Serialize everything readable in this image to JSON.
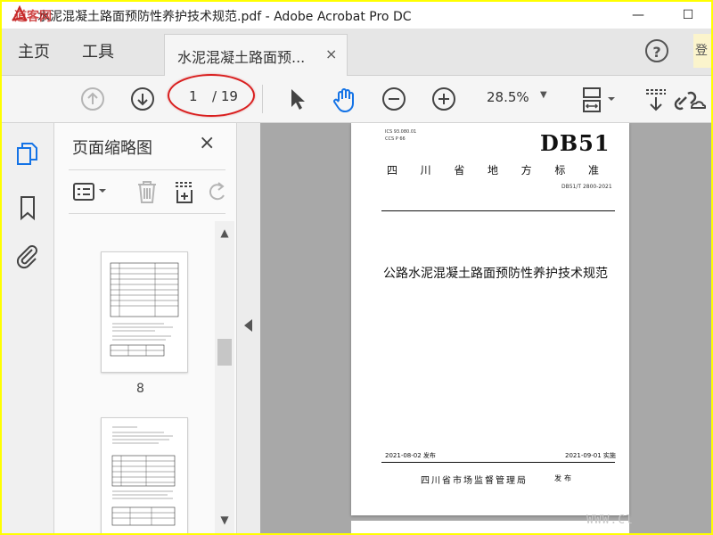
{
  "window": {
    "title": "水泥混凝土路面预防性养护技术规范.pdf - Adobe Acrobat Pro DC",
    "minimize_glyph": "—",
    "maximize_glyph": "☐"
  },
  "tabs": {
    "home_label": "主页",
    "tools_label": "工具",
    "doc_tab_label": "水泥混凝土路面预...",
    "doc_tab_close": "×",
    "help_glyph": "?",
    "signin_label": "登"
  },
  "toolbar": {
    "page_current": "1",
    "page_total": "/ 19",
    "zoom_value": "28.5%"
  },
  "thumbnail_panel": {
    "title": "页面缩略图",
    "close_glyph": "×",
    "pages": [
      {
        "number": "8"
      }
    ]
  },
  "document": {
    "ics_line1": "ICS 93.080.01",
    "ics_line2": "CCS P 66",
    "standard_code": "DB51",
    "province_standard": "四川省地方标准",
    "standard_number": "DB51/T 2800-2021",
    "title": "公路水泥混凝土路面预防性养护技术规范",
    "publish_date": "2021-08-02 发布",
    "implement_date": "2021-09-01 实施",
    "issuer": "四川省市场监督管理局",
    "issue_word": "发布"
  },
  "watermarks": {
    "corner": "道客网",
    "bottom": "WWW.Cl"
  },
  "colors": {
    "accent_blue": "#1473e6",
    "highlight_red": "#d91e1e",
    "frame_yellow": "#ffff00"
  }
}
